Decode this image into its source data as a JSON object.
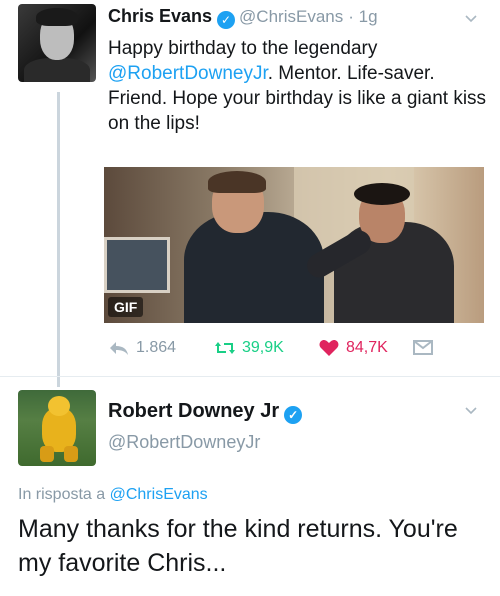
{
  "tweet1": {
    "name": "Chris Evans",
    "handle": "@ChrisEvans",
    "time": "· 1g",
    "text_before": "Happy birthday to the legendary ",
    "mention": "@RobertDowneyJr",
    "text_after": ". Mentor. Life-saver. Friend. Hope your birthday is like a giant kiss on the lips!",
    "media_badge": "GIF",
    "stats": {
      "replies": "1.864",
      "retweets": "39,9K",
      "likes": "84,7K"
    }
  },
  "tweet2": {
    "name": "Robert Downey Jr",
    "handle": "@RobertDowneyJr",
    "reply_prefix": "In risposta a ",
    "reply_mention": "@ChrisEvans",
    "text": "Many thanks for the kind returns. You're my favorite Chris..."
  },
  "icons": {
    "verified": "verified-badge-icon",
    "chevron": "chevron-down-icon",
    "reply": "reply-icon",
    "retweet": "retweet-icon",
    "like": "heart-icon",
    "dm": "direct-message-icon"
  },
  "colors": {
    "link": "#1da1f2",
    "retweet": "#19cf86",
    "like": "#e0245e",
    "muted": "#8899a6"
  }
}
